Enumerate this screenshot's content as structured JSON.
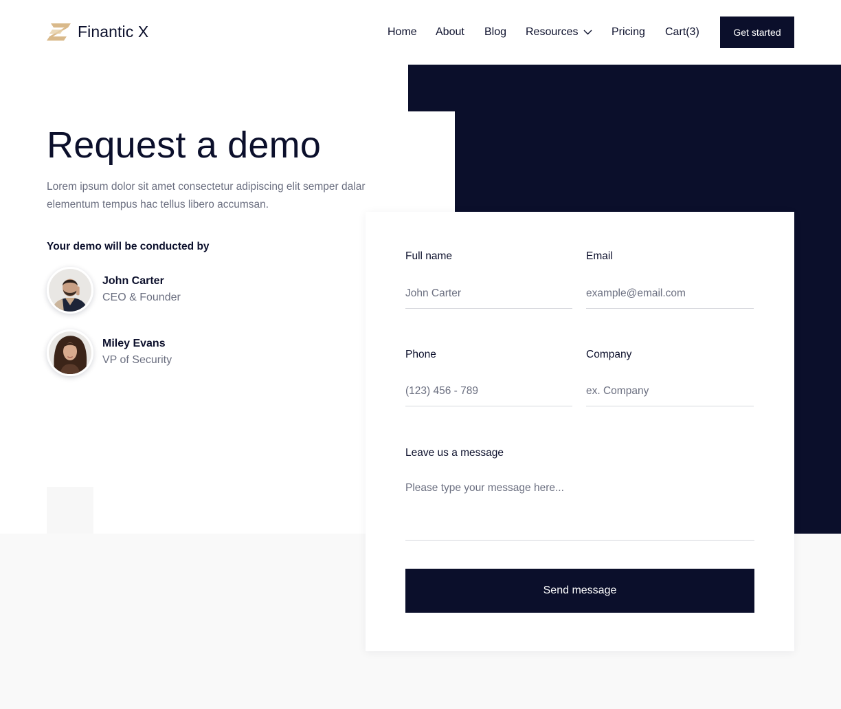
{
  "brand": {
    "name": "Finantic X",
    "logo_color": "#d9b98a"
  },
  "nav": {
    "items": [
      "Home",
      "About",
      "Blog",
      "Resources",
      "Pricing",
      "Cart(3)"
    ],
    "cta": "Get started"
  },
  "hero": {
    "title": "Request a demo",
    "description": "Lorem ipsum dolor sit amet consectetur adipiscing elit semper dalar elementum tempus hac tellus libero accumsan.",
    "conducted_by": "Your demo will be conducted by"
  },
  "people": [
    {
      "name": "John Carter",
      "role": "CEO & Founder"
    },
    {
      "name": "Miley Evans",
      "role": "VP of Security"
    }
  ],
  "form": {
    "full_name": {
      "label": "Full name",
      "placeholder": "John Carter"
    },
    "email": {
      "label": "Email",
      "placeholder": "example@email.com"
    },
    "phone": {
      "label": "Phone",
      "placeholder": "(123) 456 - 789"
    },
    "company": {
      "label": "Company",
      "placeholder": "ex. Company"
    },
    "message": {
      "label": "Leave us a message",
      "placeholder": "Please type your message here..."
    },
    "submit": "Send message"
  },
  "colors": {
    "dark": "#0b0f2b",
    "muted": "#6b6f80",
    "accent": "#d9b98a",
    "light_bg": "#f9f9f9"
  },
  "icons": {
    "logo": "finantic-logo-icon",
    "dropdown": "chevron-down-icon"
  }
}
